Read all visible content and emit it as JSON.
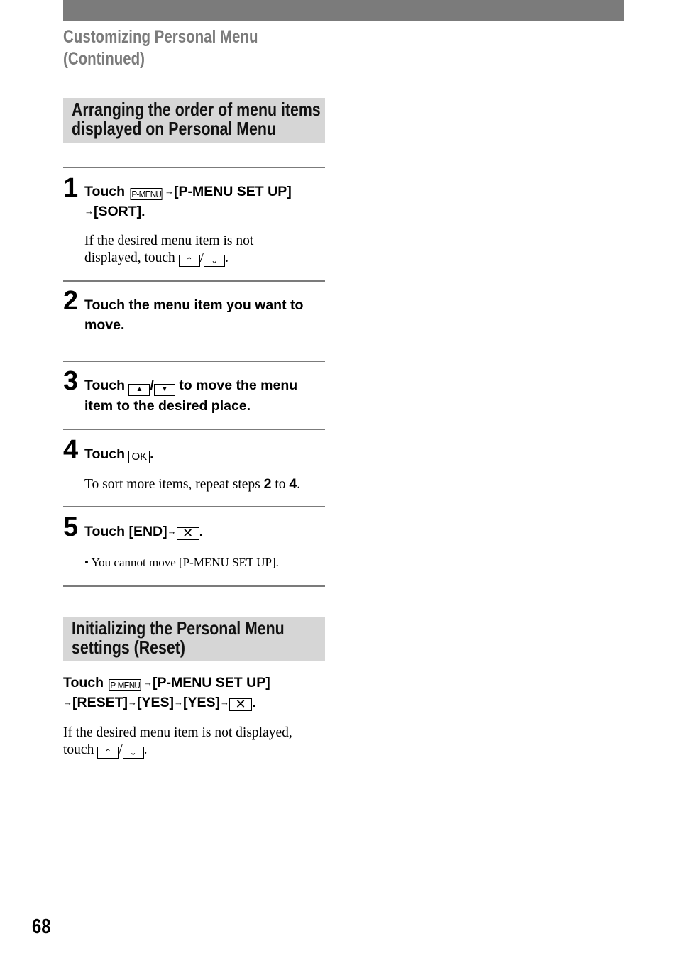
{
  "header": {
    "title_line1": "Customizing Personal Menu",
    "title_line2": "(Continued)"
  },
  "section1": {
    "heading_line1": "Arranging the order of menu items",
    "heading_line2": "displayed on Personal Menu",
    "steps": [
      {
        "number": "1",
        "text_touch": "Touch",
        "icon_pmenu": "P-MENU",
        "arrow": "→",
        "text_part1": "[P-MENU SET UP]",
        "text_part2": "[SORT].",
        "note_line1": "If the desired menu item is not",
        "note_line2": "displayed, touch",
        "icon_up": "≈up",
        "slash": "/",
        "period": "."
      },
      {
        "number": "2",
        "text": "Touch the menu item you want to move."
      },
      {
        "number": "3",
        "text_touch": "Touch",
        "slash": "/",
        "text_rest": "to move the menu item to the desired place."
      },
      {
        "number": "4",
        "text_touch": "Touch",
        "icon_ok": "OK",
        "period": ".",
        "note_pre": "To sort more items, repeat steps",
        "note_step_a": "2",
        "note_mid": "to",
        "note_step_b": "4",
        "note_end": "."
      },
      {
        "number": "5",
        "text_touch": "Touch [END]",
        "arrow": "→",
        "period": ".",
        "bullet": "•",
        "note": "You cannot move [P-MENU SET UP]."
      }
    ]
  },
  "section2": {
    "heading_line1": "Initializing the Personal Menu",
    "heading_line2": "settings (Reset)",
    "instr_touch": "Touch",
    "icon_pmenu": "P-MENU",
    "arrow": "→",
    "instr_part1": "[P-MENU SET UP]",
    "instr_reset": "[RESET]",
    "instr_yes": "[YES]",
    "period": ".",
    "note_line1": "If the desired menu item is not displayed,",
    "note_line2": "touch",
    "slash": "/"
  },
  "icons": {
    "scroll_up": "scroll-up-double-chevron",
    "scroll_down": "scroll-down-double-chevron",
    "move_up": "up-triangle",
    "move_down": "down-triangle",
    "close": "close-x"
  },
  "footer": {
    "page_number": "68"
  },
  "colors": {
    "bar_gray": "#7b7b7b",
    "heading_bg": "#d6d6d6"
  }
}
